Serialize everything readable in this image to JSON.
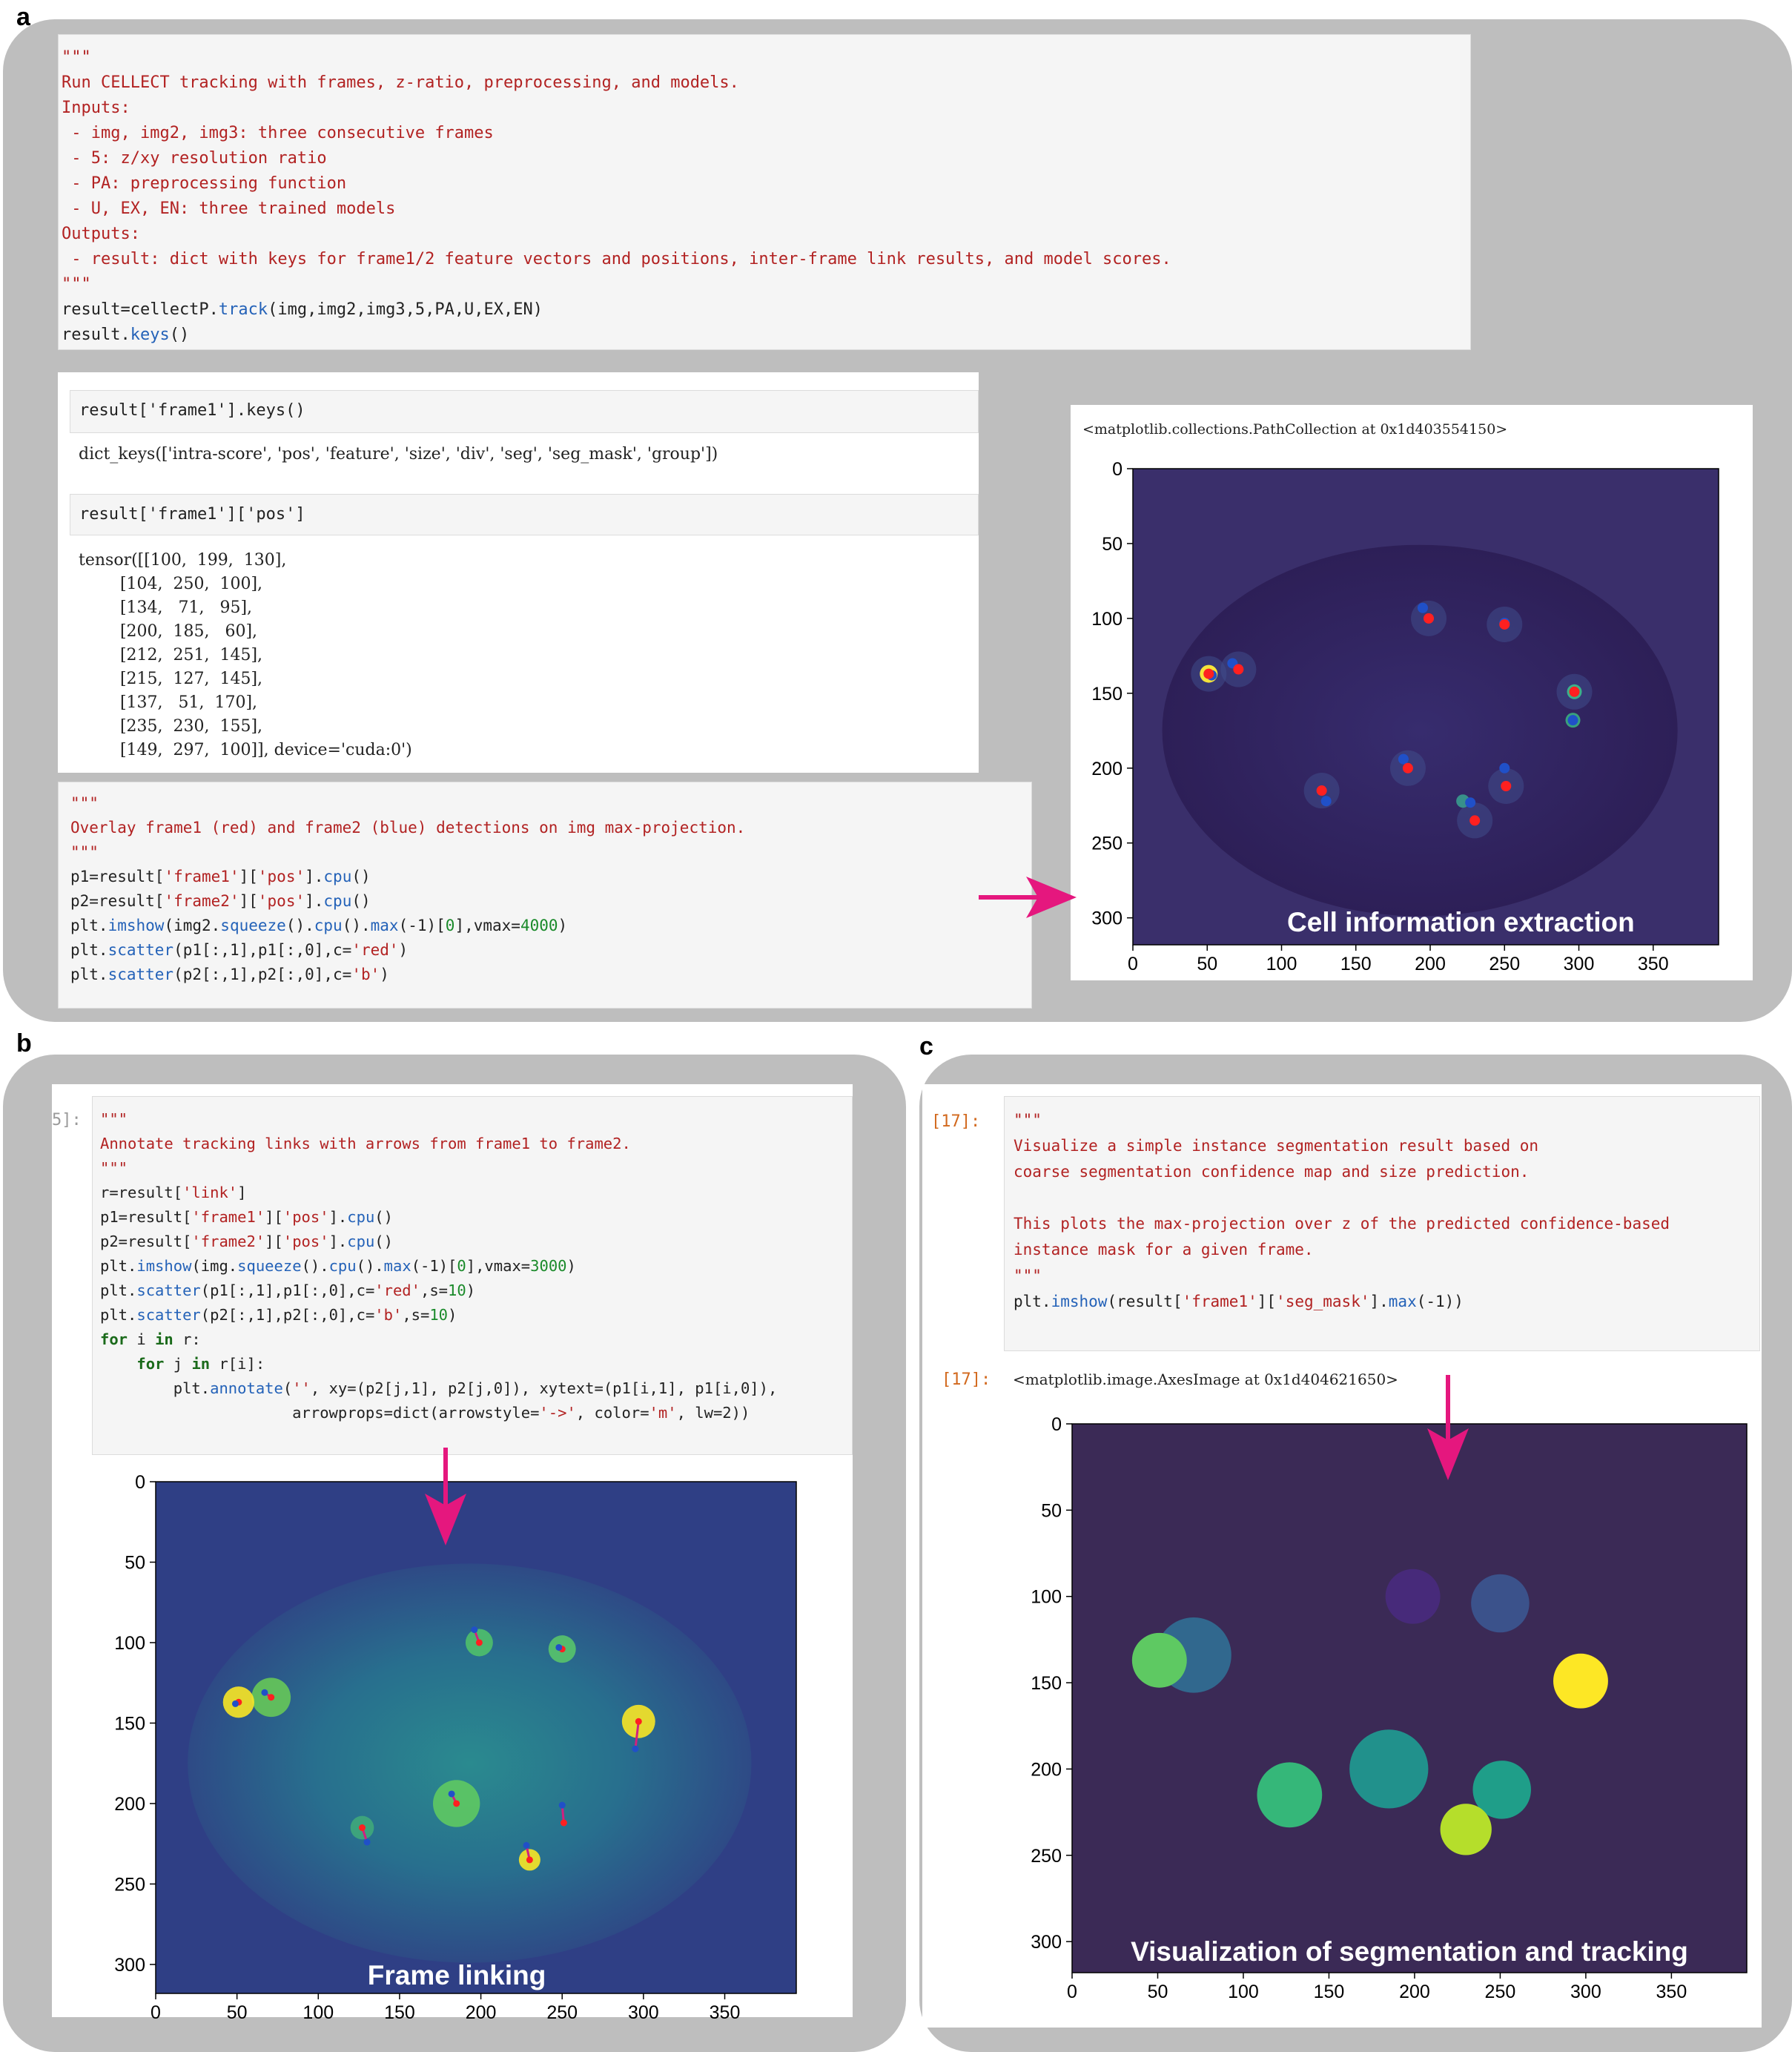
{
  "panels": {
    "a": "a",
    "b": "b",
    "c": "c"
  },
  "panel_a": {
    "code_lines": [
      "\"\"\"",
      "Run CELLECT tracking with frames, z-ratio, preprocessing, and models.",
      "Inputs:",
      " - img, img2, img3: three consecutive frames",
      " - 5: z/xy resolution ratio",
      " - PA: preprocessing function",
      " - U, EX, EN: three trained models",
      "Outputs:",
      " - result: dict with keys for frame1/2 feature vectors and positions, inter-frame link results, and model scores.",
      "\"\"\"",
      "result=cellectP.track(img,img2,img3,5,PA,U,EX,EN)",
      "result.keys()"
    ],
    "in1": "result['frame1'].keys()",
    "out1": "dict_keys(['intra-score', 'pos', 'feature', 'size', 'div', 'seg', 'seg_mask', 'group'])",
    "in2": "result['frame1']['pos']",
    "tensor_lines": [
      "tensor([[100,  199,  130],",
      "        [104,  250,  100],",
      "        [134,   71,   95],",
      "        [200,  185,   60],",
      "        [212,  251,  145],",
      "        [215,  127,  145],",
      "        [137,   51,  170],",
      "        [235,  230,  155],",
      "        [149,  297,  100]], device='cuda:0')"
    ],
    "code2_lines": [
      "\"\"\"",
      "Overlay frame1 (red) and frame2 (blue) detections on img max-projection.",
      "\"\"\"",
      "p1=result['frame1']['pos'].cpu()",
      "p2=result['frame2']['pos'].cpu()",
      "plt.imshow(img2.squeeze().cpu().max(-1)[0],vmax=4000)",
      "plt.scatter(p1[:,1],p1[:,0],c='red')",
      "plt.scatter(p2[:,1],p2[:,0],c='b')"
    ],
    "plot_output": "<matplotlib.collections.PathCollection at 0x1d403554150>",
    "plot_caption": "Cell information extraction"
  },
  "panel_b": {
    "prompt": "5]:",
    "code_lines": [
      "\"\"\"",
      "Annotate tracking links with arrows from frame1 to frame2.",
      "\"\"\"",
      "r=result['link']",
      "p1=result['frame1']['pos'].cpu()",
      "p2=result['frame2']['pos'].cpu()",
      "plt.imshow(img.squeeze().cpu().max(-1)[0],vmax=3000)",
      "plt.scatter(p1[:,1],p1[:,0],c='red',s=10)",
      "plt.scatter(p2[:,1],p2[:,0],c='b',s=10)",
      "for i in r:",
      "    for j in r[i]:",
      "        plt.annotate('', xy=(p2[j,1], p2[j,0]), xytext=(p1[i,1], p1[i,0]),",
      "                     arrowprops=dict(arrowstyle='->', color='m', lw=2))"
    ],
    "plot_caption": "Frame linking"
  },
  "panel_c": {
    "in_prompt": "[17]:",
    "code_lines": [
      "\"\"\"",
      "Visualize a simple instance segmentation result based on",
      "coarse segmentation confidence map and size prediction.",
      "",
      "This plots the max-projection over z of the predicted confidence-based",
      "instance mask for a given frame.",
      "\"\"\"",
      "plt.imshow(result['frame1']['seg_mask'].max(-1))"
    ],
    "out_prompt": "[17]:",
    "plot_output": "<matplotlib.image.AxesImage at 0x1d404621650>",
    "plot_caption": "Visualization of segmentation and tracking"
  },
  "chart_data": [
    {
      "type": "scatter",
      "title": "",
      "x_ticks": [
        0,
        50,
        100,
        150,
        200,
        250,
        300,
        350
      ],
      "y_ticks": [
        0,
        50,
        100,
        150,
        200,
        250,
        300
      ],
      "xlim": [
        0,
        394
      ],
      "ylim": [
        0,
        318
      ],
      "series": [
        {
          "name": "frame1",
          "color": "#ff2020",
          "x": [
            199,
            250,
            71,
            185,
            251,
            127,
            51,
            230,
            297
          ],
          "y": [
            100,
            104,
            134,
            200,
            212,
            215,
            137,
            235,
            149
          ]
        },
        {
          "name": "frame2",
          "color": "#2050c8",
          "x": [
            195,
            250,
            67,
            182,
            250,
            130,
            53,
            227,
            296
          ],
          "y": [
            93,
            103,
            130,
            194,
            200,
            222,
            138,
            223,
            168
          ]
        }
      ],
      "caption": "Cell information extraction"
    },
    {
      "type": "scatter",
      "title": "",
      "x_ticks": [
        0,
        50,
        100,
        150,
        200,
        250,
        300,
        350
      ],
      "y_ticks": [
        0,
        50,
        100,
        150,
        200,
        250,
        300
      ],
      "xlim": [
        0,
        394
      ],
      "ylim": [
        0,
        318
      ],
      "series": [
        {
          "name": "frame1",
          "color": "#ff2020",
          "x": [
            199,
            250,
            71,
            185,
            251,
            127,
            51,
            230,
            297
          ],
          "y": [
            100,
            104,
            134,
            200,
            212,
            215,
            137,
            235,
            149
          ]
        },
        {
          "name": "frame2",
          "color": "#2050c8",
          "x": [
            196,
            248,
            67,
            182,
            250,
            130,
            49,
            228,
            295
          ],
          "y": [
            92,
            103,
            131,
            194,
            201,
            224,
            138,
            226,
            166
          ]
        }
      ],
      "caption": "Frame linking"
    },
    {
      "type": "heatmap",
      "title": "",
      "x_ticks": [
        0,
        50,
        100,
        150,
        200,
        250,
        300,
        350
      ],
      "y_ticks": [
        0,
        50,
        100,
        150,
        200,
        250,
        300
      ],
      "xlim": [
        0,
        394
      ],
      "ylim": [
        0,
        318
      ],
      "instances": [
        {
          "x": 199,
          "y": 100,
          "r": 16,
          "color": "#472a7a"
        },
        {
          "x": 250,
          "y": 104,
          "r": 17,
          "color": "#3b528b"
        },
        {
          "x": 71,
          "y": 134,
          "r": 22,
          "color": "#31688e"
        },
        {
          "x": 51,
          "y": 137,
          "r": 16,
          "color": "#5ec962"
        },
        {
          "x": 297,
          "y": 149,
          "r": 16,
          "color": "#fde725"
        },
        {
          "x": 185,
          "y": 200,
          "r": 23,
          "color": "#21918c"
        },
        {
          "x": 251,
          "y": 212,
          "r": 17,
          "color": "#1f9e89"
        },
        {
          "x": 127,
          "y": 215,
          "r": 19,
          "color": "#35b779"
        },
        {
          "x": 230,
          "y": 235,
          "r": 15,
          "color": "#b5de2b"
        }
      ],
      "caption": "Visualization of segmentation and tracking"
    }
  ]
}
